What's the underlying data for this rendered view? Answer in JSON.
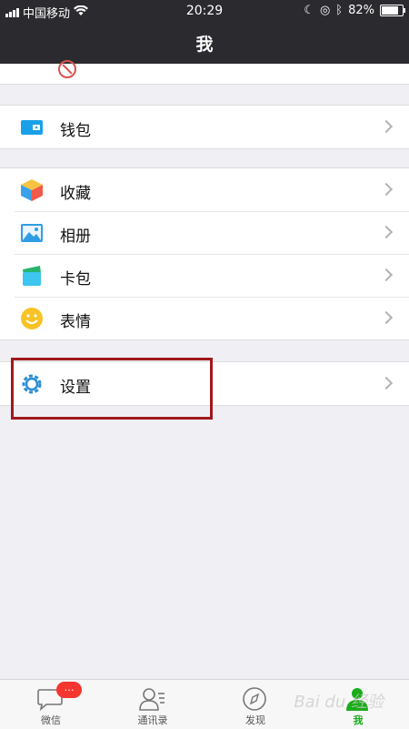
{
  "status_bar": {
    "carrier": "中国移动",
    "time": "20:29",
    "battery": "82%",
    "battery_level": 0.82
  },
  "nav": {
    "title": "我"
  },
  "groups": {
    "wallet": {
      "label": "钱包"
    },
    "favorites": {
      "label": "收藏"
    },
    "album": {
      "label": "相册"
    },
    "cards": {
      "label": "卡包"
    },
    "stickers": {
      "label": "表情"
    },
    "settings": {
      "label": "设置"
    }
  },
  "tabs": [
    {
      "label": "微信",
      "badge": "…"
    },
    {
      "label": "通讯录"
    },
    {
      "label": "发现"
    },
    {
      "label": "我"
    }
  ],
  "watermark": "Bai du 经验",
  "colors": {
    "active_tab": "#1aad19",
    "highlight_box": "#a0191c",
    "badge_red": "#f43530"
  }
}
